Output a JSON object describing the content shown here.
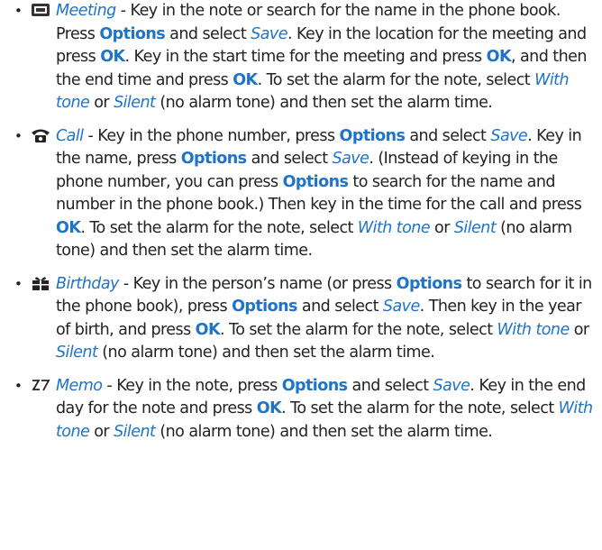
{
  "items": [
    {
      "icon": "meeting-icon",
      "parts": [
        {
          "t": "Meeting",
          "s": "em"
        },
        {
          "t": " - Key in the note or search for the name in the phone book. Press ",
          "s": ""
        },
        {
          "t": "Options",
          "s": "b"
        },
        {
          "t": " and select ",
          "s": ""
        },
        {
          "t": "Save",
          "s": "em"
        },
        {
          "t": ". Key in the location for the meeting and press ",
          "s": ""
        },
        {
          "t": "OK",
          "s": "b"
        },
        {
          "t": ". Key in the start time for the meeting and press ",
          "s": ""
        },
        {
          "t": "OK",
          "s": "b"
        },
        {
          "t": ", and then the end time and press ",
          "s": ""
        },
        {
          "t": "OK",
          "s": "b"
        },
        {
          "t": ". To set the alarm for the note, select ",
          "s": ""
        },
        {
          "t": "With tone",
          "s": "em"
        },
        {
          "t": " or ",
          "s": ""
        },
        {
          "t": "Silent",
          "s": "em"
        },
        {
          "t": " (no alarm tone) and then set the alarm time.",
          "s": ""
        }
      ]
    },
    {
      "icon": "call-icon",
      "parts": [
        {
          "t": "Call",
          "s": "em"
        },
        {
          "t": " - Key in the phone number, press ",
          "s": ""
        },
        {
          "t": "Options",
          "s": "b"
        },
        {
          "t": " and select ",
          "s": ""
        },
        {
          "t": "Save",
          "s": "em"
        },
        {
          "t": ". Key in the name, press ",
          "s": ""
        },
        {
          "t": "Options",
          "s": "b"
        },
        {
          "t": " and select ",
          "s": ""
        },
        {
          "t": "Save",
          "s": "em"
        },
        {
          "t": ". (Instead of keying in the phone number, you can press ",
          "s": ""
        },
        {
          "t": "Options",
          "s": "b"
        },
        {
          "t": " to search for the name and number in the phone book.) Then key in the time for the call and press ",
          "s": ""
        },
        {
          "t": "OK",
          "s": "b"
        },
        {
          "t": ". To set the alarm for the note, select ",
          "s": ""
        },
        {
          "t": "With tone",
          "s": "em"
        },
        {
          "t": " or ",
          "s": ""
        },
        {
          "t": "Silent",
          "s": "em"
        },
        {
          "t": " (no alarm tone) and then set the alarm time.",
          "s": ""
        }
      ]
    },
    {
      "icon": "birthday-icon",
      "parts": [
        {
          "t": "Birthday",
          "s": "em"
        },
        {
          "t": " - Key in the person’s name (or press ",
          "s": ""
        },
        {
          "t": "Options",
          "s": "b"
        },
        {
          "t": " to search for it in the phone book), press ",
          "s": ""
        },
        {
          "t": "Options",
          "s": "b"
        },
        {
          "t": " and select ",
          "s": ""
        },
        {
          "t": "Save",
          "s": "em"
        },
        {
          "t": ". Then key in the year of birth, and press ",
          "s": ""
        },
        {
          "t": "OK",
          "s": "b"
        },
        {
          "t": ". To set the alarm for the note, select ",
          "s": ""
        },
        {
          "t": "With tone",
          "s": "em"
        },
        {
          "t": " or ",
          "s": ""
        },
        {
          "t": "Silent",
          "s": "em"
        },
        {
          "t": " (no alarm tone) and then set the alarm time.",
          "s": ""
        }
      ]
    },
    {
      "icon": "memo-icon",
      "parts": [
        {
          "t": "Memo",
          "s": "em"
        },
        {
          "t": " - Key in the note, press ",
          "s": ""
        },
        {
          "t": "Options",
          "s": "b"
        },
        {
          "t": " and select ",
          "s": ""
        },
        {
          "t": "Save",
          "s": "em"
        },
        {
          "t": ". Key in the end day for the note and press ",
          "s": ""
        },
        {
          "t": "OK",
          "s": "b"
        },
        {
          "t": ". To set the alarm for the note, select ",
          "s": ""
        },
        {
          "t": "With tone",
          "s": "em"
        },
        {
          "t": " or ",
          "s": ""
        },
        {
          "t": "Silent",
          "s": "em"
        },
        {
          "t": " (no alarm tone) and then set the alarm time.",
          "s": ""
        }
      ]
    }
  ],
  "colors": {
    "accent": "#1f73c9",
    "text": "#222222"
  }
}
